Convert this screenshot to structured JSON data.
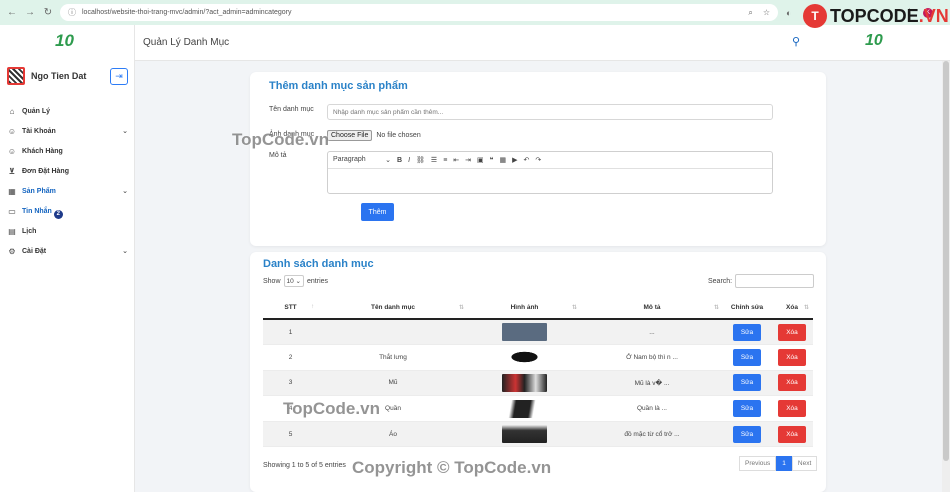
{
  "browser": {
    "url": "localhost/website-thoi-trang-mvc/admin/?act_admin=admincategory",
    "avatar_letter": "K"
  },
  "brand": {
    "text_top": "TOPCODE",
    "text_dot": ".VN",
    "mark": "T"
  },
  "sidebar": {
    "logo": "10",
    "user_name": "Ngo Tien Dat",
    "items": [
      {
        "label": "Quản Lý",
        "icon": "home-icon"
      },
      {
        "label": "Tài Khoản",
        "icon": "user-icon",
        "arrow": "⌄"
      },
      {
        "label": "Khách Hàng",
        "icon": "user-icon"
      },
      {
        "label": "Đơn Đặt Hàng",
        "icon": "cart-icon"
      },
      {
        "label": "Sản Phẩm",
        "icon": "grid-icon",
        "arrow": "⌄"
      },
      {
        "label": "Tin Nhắn",
        "icon": "chat-icon",
        "badge": "2"
      },
      {
        "label": "Lịch",
        "icon": "calendar-icon"
      },
      {
        "label": "Cài Đặt",
        "icon": "gear-icon",
        "arrow": "⌄"
      }
    ]
  },
  "header": {
    "title": "Quản Lý Danh Mục",
    "logo": "10"
  },
  "form": {
    "title": "Thêm danh mục sản phẩm",
    "name_label": "Tên danh mục",
    "name_placeholder": "Nhập danh mục sản phẩm cần thêm...",
    "image_label": "Ảnh danh mục",
    "choose_file": "Choose File",
    "no_file": "No file chosen",
    "desc_label": "Mô tả",
    "paragraph": "Paragraph",
    "submit": "Thêm"
  },
  "list": {
    "title": "Danh sách danh mục",
    "show": "Show",
    "entries_value": "10",
    "entries": "entries",
    "search": "Search:",
    "columns": [
      "STT",
      "Tên danh mục",
      "Hình ảnh",
      "Mô tả",
      "Chỉnh sửa",
      "Xóa"
    ],
    "rows": [
      {
        "stt": "1",
        "name": "",
        "desc": "...",
        "img": "#5a6b80"
      },
      {
        "stt": "2",
        "name": "Thắt lưng",
        "desc": "Ở Nam bộ thì n ...",
        "img": "#1d1d1d"
      },
      {
        "stt": "3",
        "name": "Mũ",
        "desc": "Mũ là v� ...",
        "img": "#2a2a2a"
      },
      {
        "stt": "4",
        "name": "Quần",
        "desc": "Quần là ...",
        "img": "#3a3a3a"
      },
      {
        "stt": "5",
        "name": "Áo",
        "desc": "đồ mặc từ cổ trở ...",
        "img": "#222222"
      }
    ],
    "edit": "Sửa",
    "delete": "Xóa",
    "info": "Showing 1 to 5 of 5 entries",
    "prev": "Previous",
    "page": "1",
    "next": "Next"
  },
  "watermarks": [
    "TopCode.vn",
    "TopCode.vn",
    "Copyright © TopCode.vn"
  ]
}
